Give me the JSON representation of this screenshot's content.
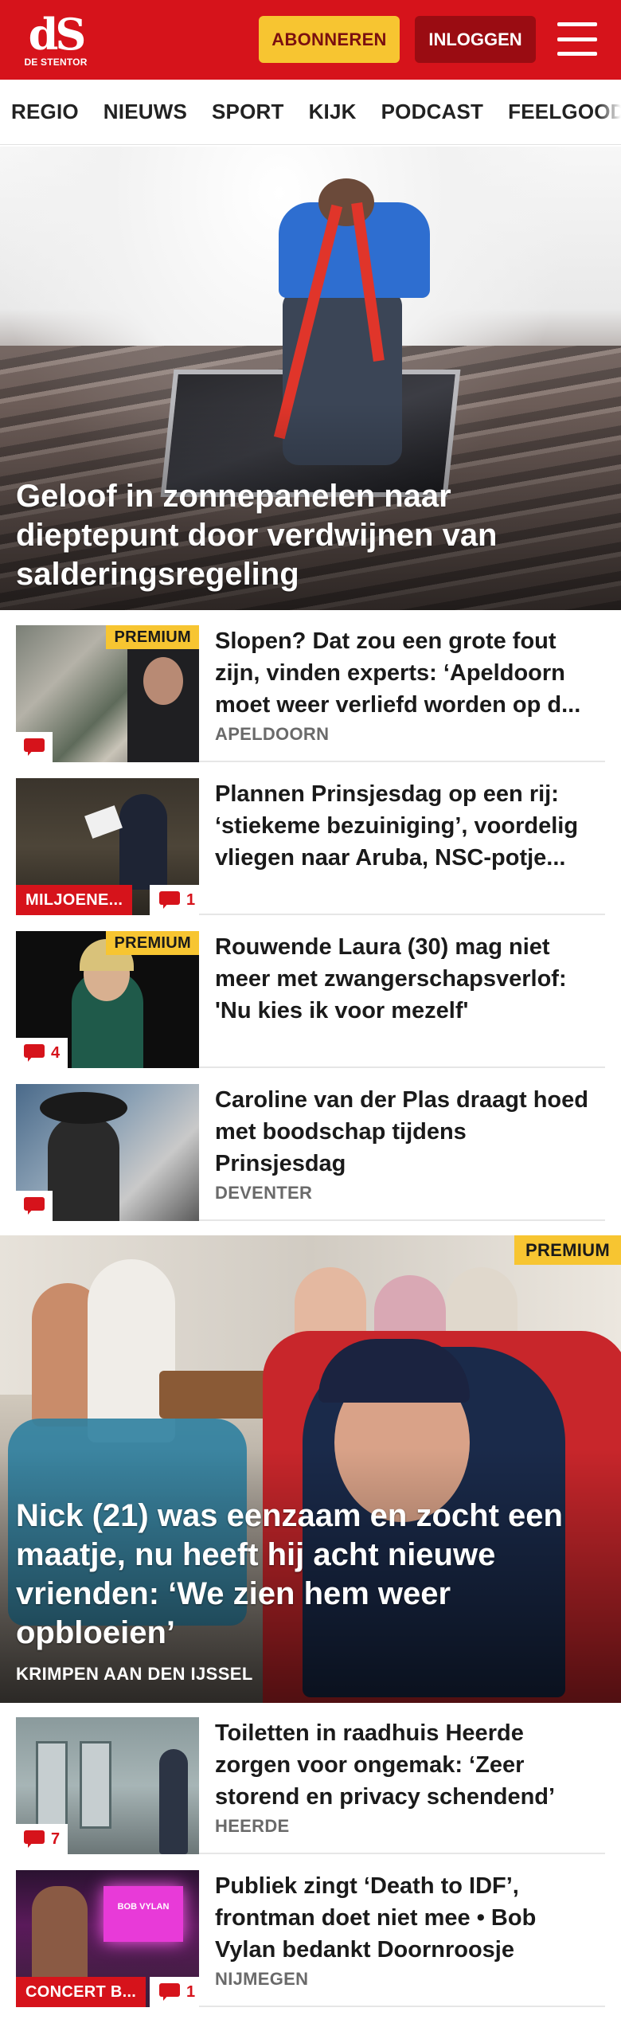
{
  "header": {
    "logo_mark": "dS",
    "logo_text": "DE STENTOR",
    "subscribe_label": "ABONNEREN",
    "login_label": "INLOGGEN",
    "menu_icon": "hamburger-icon",
    "brand_color": "#d6131b",
    "subscribe_color": "#f7c531"
  },
  "nav": {
    "items": [
      "REGIO",
      "NIEUWS",
      "SPORT",
      "KIJK",
      "PODCAST",
      "FEELGOOD"
    ]
  },
  "hero": {
    "title": "Geloof in zonnepanelen naar dieptepunt door verdwijnen van salderingsregeling"
  },
  "articles": [
    {
      "title": "Slopen? Dat zou een grote fout zijn, vinden experts: ‘Apeldoorn moet weer verliefd worden op d...",
      "category": "APELDOORN",
      "badge": "PREMIUM",
      "comments": ""
    },
    {
      "title": "Plannen Prinsjesdag op een rij: ‘stiekeme bezuiniging’, voordelig vliegen naar Aruba, NSC-potje...",
      "category": "",
      "tag": "MILJOENE...",
      "comments": "1"
    },
    {
      "title": "Rouwende Laura (30) mag niet meer met zwangerschapsverlof: 'Nu kies ik voor mezelf'",
      "category": "",
      "badge": "PREMIUM",
      "comments": "4"
    },
    {
      "title": "Caroline van der Plas draagt hoed met boodschap tijdens Prinsjesdag",
      "category": "DEVENTER",
      "comments": ""
    }
  ],
  "feature": {
    "badge": "PREMIUM",
    "title": "Nick (21) was eenzaam en zocht een maatje, nu heeft hij acht nieuwe vrienden: ‘We zien hem weer opbloeien’",
    "category": "KRIMPEN AAN DEN IJSSEL"
  },
  "articles2": [
    {
      "title": "Toiletten in raadhuis Heerde zorgen voor ongemak: ‘Zeer storend en privacy schendend’",
      "category": "HEERDE",
      "comments": "7"
    },
    {
      "title": "Publiek zingt ‘Death to IDF’, frontman doet niet mee • Bob Vylan bedankt Doornroosje",
      "category": "NIJMEGEN",
      "tag": "CONCERT B...",
      "comments": "1",
      "thumb_sign": "BOB VYLAN"
    }
  ]
}
